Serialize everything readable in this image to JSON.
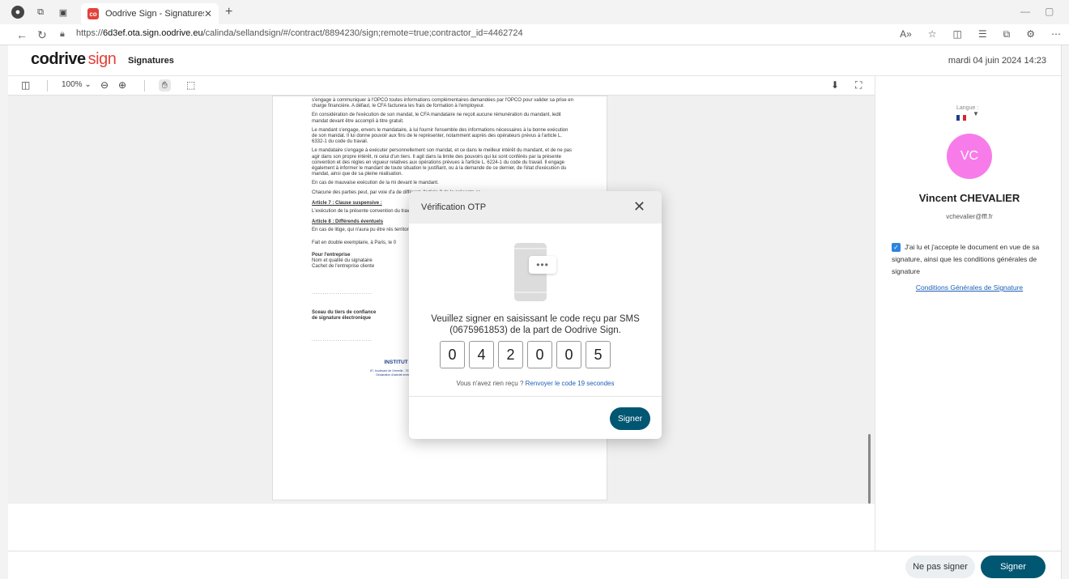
{
  "browser": {
    "tab_title": "Oodrive Sign - Signatures",
    "tab_favicon": "co",
    "url_prefix": "https://",
    "url_domain": "6d3ef.ota.sign.oodrive.eu",
    "url_path": "/calinda/sellandsign/#/contract/8894230/sign;remote=true;contractor_id=4462724"
  },
  "header": {
    "logo_main": "codrive",
    "logo_accent": "sign",
    "title": "Signatures",
    "datetime": "mardi 04 juin 2024 14:23"
  },
  "toolbar": {
    "zoom": "100%"
  },
  "document": {
    "p1": "s'engage à communiquer à l'OPCO toutes informations complémentaires demandées par l'OPCO pour valider sa prise en charge financière. A défaut, le CFA facturera les frais de formation à l'employeur.",
    "p2": "En considération de l'exécution de son mandat, le CFA mandataire ne reçoit aucune rémunération du mandant, ledit mandat devant être accompli à titre gratuit.",
    "p3": "Le mandant s'engage, envers le mandataire, à lui fournir l'ensemble des informations nécessaires à la bonne exécution de son mandat. Il lui donne pouvoir aux fins de le représenter, notamment auprès des opérateurs prévus à l'article L. 6332-1 du code du travail.",
    "p4": "Le mandataire s'engage à exécuter personnellement son mandat, et ce dans le meilleur intérêt du mandant, et de ne pas agir dans son propre intérêt, ni celui d'un tiers. Il agit dans la limite des pouvoirs qui lui sont conférés par la présente convention et des règles en vigueur relatives aux opérations prévues à l'article L. 6224-1 du code du travail. Il engage également à informer le mandant de toute situation le justifiant, ou à la demande de ce dernier, de l'état d'exécution du mandat, ainsi que de sa pleine réalisation.",
    "p5": "En cas de mauvaise exécution de la mi devant le mandant.",
    "p6": "Chacune des parties peut, par voie d'a de différent, l'article 8 de la présente cc",
    "art7_title": "Article 7 : Clause suspensive :",
    "art7_text": "L'exécution de la présente convention du travail) auprès des services du mini",
    "art8_title": "Article 8 : Différends éventuels",
    "art8_text": "En cas de litige, qui n'aura pu être rés territoriale compétente.",
    "fait": "Fait en double exemplaire, à Paris, le 0",
    "entreprise_title": "Pour l'entreprise",
    "entreprise_l1": "Nom et qualité du signataire",
    "entreprise_l2": "Cachet de l'entreprise cliente",
    "dots1": "............................",
    "sceau_l1": "Sceau du tiers de confiance",
    "sceau_l2": "de signature électronique",
    "dots2": "............................",
    "institute": "INSTITUT EMPLOI FORMATION DU FOOTBALL",
    "institute_addr1": "87, boulevard de Grenelle - 75738 Paris Cedex 15 - Tél. +33 (0)1 44 31 73 13 - Mail : institut-emploi-formation@fff.fr",
    "institute_addr2": "Déclaration d'activité enregistrée sous le numéro 11754697875 auprès du préfet de la région Ile-de-France",
    "institute_addr3": "Siret n° 524 712 325 00012 - Code NAF 85.59A"
  },
  "panel": {
    "language_label": "Langue :",
    "flag_colors": [
      "#1f3d8a",
      "#ffffff",
      "#d7262e"
    ],
    "avatar_initials": "VC",
    "avatar_color": "#f77ce9",
    "user_name": "Vincent CHEVALIER",
    "user_email": "vchevalier@fff.fr",
    "accept_text": "J'ai lu et j'accepte le document en vue de sa signature, ainsi que les conditions générales de signature",
    "accept_checked": true,
    "cgs_link": "Conditions Générales de Signature"
  },
  "bottom": {
    "decline_label": "Ne pas signer",
    "sign_label": "Signer"
  },
  "modal": {
    "title": "Vérification OTP",
    "bubble_dots": "•••",
    "instruction_l1": "Veuillez signer en saisissant le code reçu par SMS",
    "instruction_l2": "(0675961853) de la part de Oodrive Sign.",
    "otp_digits": [
      "0",
      "4",
      "2",
      "0",
      "0",
      "5"
    ],
    "resend_prefix": "Vous n'avez rien reçu ?",
    "resend_link": "Renvoyer le code 19 secondes",
    "sign_label": "Signer"
  },
  "colors": {
    "brand_accent": "#e4413a",
    "primary_button": "#015672",
    "link": "#1d5fb8",
    "checkbox": "#2b84e0"
  }
}
